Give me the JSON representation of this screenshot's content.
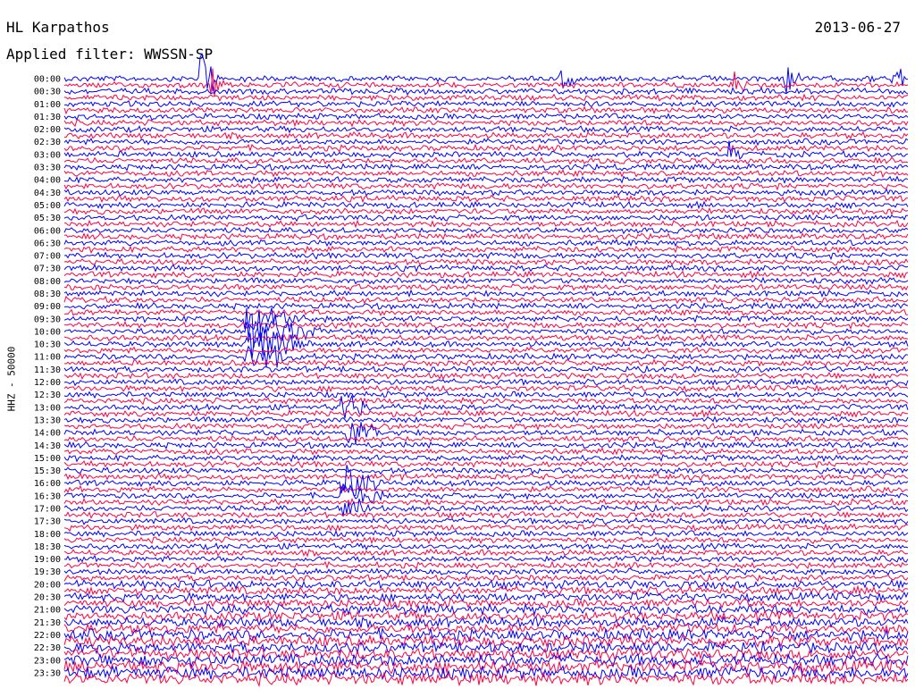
{
  "header": {
    "station": "HL Karpathos",
    "date": "2013-06-27",
    "filter": "Applied filter: WWSSN-SP"
  },
  "channel_label": "HHZ - 50000",
  "colors": {
    "trace_a": "#0000ff",
    "trace_b": "#ff0040",
    "background": "#ffffff"
  },
  "chart_data": {
    "type": "line",
    "title": "HL Karpathos",
    "subtitle": "Applied filter: WWSSN-SP",
    "ylabel": "HHZ - 50000",
    "xlabel": "",
    "x_unit": "minutes",
    "xlim": [
      0,
      15
    ],
    "row_interval_minutes": 15,
    "rows": [
      "00:00",
      "00:15",
      "00:30",
      "00:45",
      "01:00",
      "01:15",
      "01:30",
      "01:45",
      "02:00",
      "02:15",
      "02:30",
      "02:45",
      "03:00",
      "03:15",
      "03:30",
      "03:45",
      "04:00",
      "04:15",
      "04:30",
      "04:45",
      "05:00",
      "05:15",
      "05:30",
      "05:45",
      "06:00",
      "06:15",
      "06:30",
      "06:45",
      "07:00",
      "07:15",
      "07:30",
      "07:45",
      "08:00",
      "08:15",
      "08:30",
      "08:45",
      "09:00",
      "09:15",
      "09:30",
      "09:45",
      "10:00",
      "10:15",
      "10:30",
      "10:45",
      "11:00",
      "11:15",
      "11:30",
      "11:45",
      "12:00",
      "12:15",
      "12:30",
      "12:45",
      "13:00",
      "13:15",
      "13:30",
      "13:45",
      "14:00",
      "14:15",
      "14:30",
      "14:45",
      "15:00",
      "15:15",
      "15:30",
      "15:45",
      "16:00",
      "16:15",
      "16:30",
      "16:45",
      "17:00",
      "17:15",
      "17:30",
      "17:45",
      "18:00",
      "18:15",
      "18:30",
      "18:45",
      "19:00",
      "19:15",
      "19:30",
      "19:45",
      "20:00",
      "20:15",
      "20:30",
      "20:45",
      "21:00",
      "21:15",
      "21:30",
      "21:45",
      "22:00",
      "22:15",
      "22:30",
      "22:45",
      "23:00",
      "23:15",
      "23:30",
      "23:45"
    ],
    "tick_labels": [
      "00:00",
      "00:30",
      "01:00",
      "01:30",
      "02:00",
      "02:30",
      "03:00",
      "03:30",
      "04:00",
      "04:30",
      "05:00",
      "05:30",
      "06:00",
      "06:30",
      "07:00",
      "07:30",
      "08:00",
      "08:30",
      "09:00",
      "09:30",
      "10:00",
      "10:30",
      "11:00",
      "11:30",
      "12:00",
      "12:30",
      "13:00",
      "13:30",
      "14:00",
      "14:30",
      "15:00",
      "15:30",
      "16:00",
      "16:30",
      "17:00",
      "17:30",
      "18:00",
      "18:30",
      "19:00",
      "19:30",
      "20:00",
      "20:30",
      "21:00",
      "21:30",
      "22:00",
      "22:30",
      "23:00",
      "23:30"
    ],
    "events": [
      {
        "row": "00:00",
        "minute": 2.4,
        "amplitude": 9,
        "duration": 0.4
      },
      {
        "row": "00:15",
        "minute": 2.6,
        "amplitude": 5,
        "duration": 0.3
      },
      {
        "row": "00:00",
        "minute": 8.8,
        "amplitude": 6,
        "duration": 0.3
      },
      {
        "row": "00:00",
        "minute": 12.8,
        "amplitude": 6,
        "duration": 0.3
      },
      {
        "row": "00:00",
        "minute": 14.7,
        "amplitude": 6,
        "duration": 0.3
      },
      {
        "row": "00:15",
        "minute": 11.9,
        "amplitude": 5,
        "duration": 0.3
      },
      {
        "row": "03:00",
        "minute": 11.8,
        "amplitude": 3,
        "duration": 0.3
      },
      {
        "row": "09:30",
        "minute": 3.2,
        "amplitude": 6,
        "duration": 1.2
      },
      {
        "row": "10:00",
        "minute": 3.2,
        "amplitude": 6,
        "duration": 1.5
      },
      {
        "row": "10:30",
        "minute": 3.2,
        "amplitude": 5,
        "duration": 1.2
      },
      {
        "row": "11:00",
        "minute": 3.2,
        "amplitude": 5,
        "duration": 1.0
      },
      {
        "row": "13:00",
        "minute": 4.9,
        "amplitude": 4,
        "duration": 0.6
      },
      {
        "row": "14:00",
        "minute": 5.0,
        "amplitude": 4,
        "duration": 0.7
      },
      {
        "row": "16:00",
        "minute": 4.9,
        "amplitude": 5,
        "duration": 0.8
      },
      {
        "row": "16:30",
        "minute": 4.9,
        "amplitude": 5,
        "duration": 0.8
      },
      {
        "row": "17:00",
        "minute": 4.9,
        "amplitude": 4,
        "duration": 0.6
      }
    ]
  }
}
